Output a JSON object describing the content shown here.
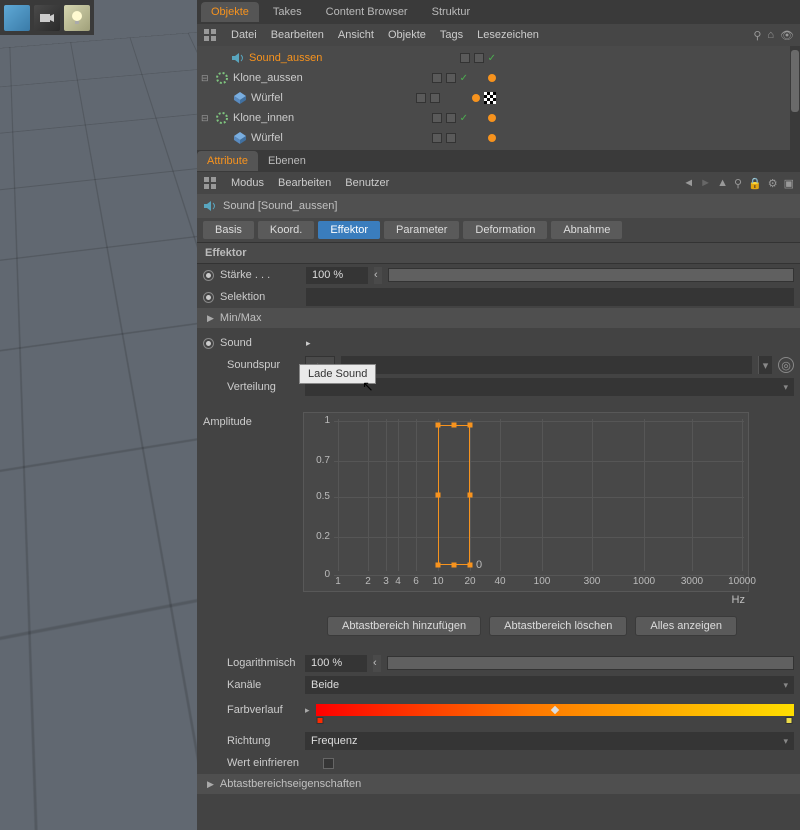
{
  "top_tabs": [
    "Objekte",
    "Takes",
    "Content Browser",
    "Struktur"
  ],
  "top_tabs_active": 0,
  "menu": [
    "Datei",
    "Bearbeiten",
    "Ansicht",
    "Objekte",
    "Tags",
    "Lesezeichen"
  ],
  "tree": [
    {
      "label": "Sound_aussen",
      "selected": true,
      "depth": 0,
      "expand": "",
      "icon": "speaker",
      "dots": [
        "orange"
      ]
    },
    {
      "label": "Klone_aussen",
      "selected": false,
      "depth": 0,
      "expand": "⊟",
      "icon": "cloner",
      "dots": [
        "orange"
      ]
    },
    {
      "label": "Würfel",
      "selected": false,
      "depth": 1,
      "expand": "",
      "icon": "cube",
      "dots": [
        "orange",
        "checker"
      ]
    },
    {
      "label": "Klone_innen",
      "selected": false,
      "depth": 0,
      "expand": "⊟",
      "icon": "cloner",
      "dots": [
        "orange"
      ]
    },
    {
      "label": "Würfel",
      "selected": false,
      "depth": 1,
      "expand": "",
      "icon": "cube",
      "dots": [
        "orange"
      ]
    }
  ],
  "attr_tabs": [
    "Attribute",
    "Ebenen"
  ],
  "attr_tabs_active": 0,
  "attr_menu": [
    "Modus",
    "Bearbeiten",
    "Benutzer"
  ],
  "object_header": "Sound [Sound_aussen]",
  "param_tabs": [
    "Basis",
    "Koord.",
    "Effektor",
    "Parameter",
    "Deformation",
    "Abnahme"
  ],
  "param_tabs_active": 2,
  "section_effektor": "Effektor",
  "props": {
    "staerke_label": "Stärke . . .",
    "staerke_value": "100 %",
    "selektion_label": "Selektion",
    "minmax_label": "Min/Max",
    "sound_label": "Sound",
    "soundspur_label": "Soundspur",
    "verteilung_label": "Verteilung",
    "amplitude_label": "Amplitude",
    "log_label": "Logarithmisch",
    "log_value": "100 %",
    "kanaele_label": "Kanäle",
    "kanaele_value": "Beide",
    "farbverlauf_label": "Farbverlauf",
    "richtung_label": "Richtung",
    "richtung_value": "Frequenz",
    "wert_einfrieren_label": "Wert einfrieren",
    "abtast_label": "Abtastbereichseigenschaften"
  },
  "popup_label": "Lade Sound",
  "buttons": {
    "add": "Abtastbereich hinzufügen",
    "del": "Abtastbereich löschen",
    "all": "Alles anzeigen"
  },
  "chart_data": {
    "type": "other",
    "title": "Amplitude",
    "xlabel": "Hz",
    "ylabel": "",
    "ylim": [
      0.0,
      1.0
    ],
    "yticks": [
      0.0,
      0.2,
      0.5,
      0.7,
      1.0
    ],
    "xticks": [
      1,
      2,
      3,
      4,
      6,
      10,
      20,
      40,
      100,
      300,
      1000,
      3000,
      10000
    ],
    "x_scale": "log",
    "selection_box": {
      "x_range": [
        10,
        20
      ],
      "y_range": [
        0.02,
        1.0
      ]
    },
    "annotation": {
      "text": "0",
      "x": 20,
      "y": 0.02,
      "position": "right"
    }
  },
  "colors": {
    "accent": "#f7931e",
    "tab_active": "#3a7dbd",
    "grad_stops": [
      "#ff0000",
      "#ff7800",
      "#ffde00"
    ]
  }
}
